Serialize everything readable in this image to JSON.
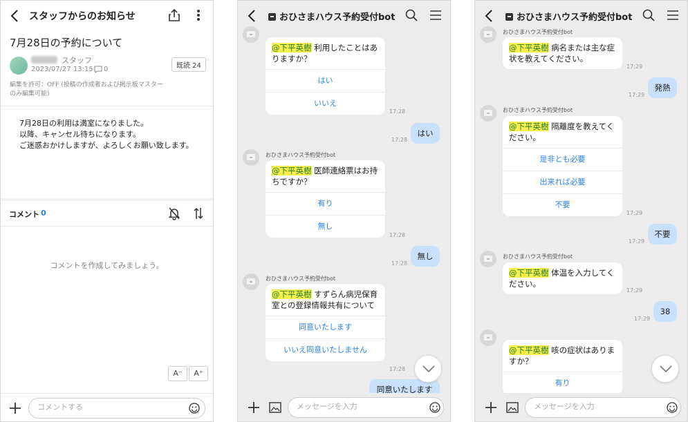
{
  "panel1": {
    "title": "スタッフからのお知らせ",
    "post_title": "7月28日の予約について",
    "author_role": "スタッフ",
    "date": "2023/07/27 13:15",
    "meta_sep": "|",
    "comment_count": "0",
    "read_badge": "既読 24",
    "permission": "編集を許可：OFF (投稿の作成者および掲示板マスターのみ編集可能)",
    "body_lines": [
      "7月28日の利用は満室になりました。",
      "以降、キャンセル待ちになります。",
      "ご迷惑おかけしますが、よろしくお願い致します。"
    ],
    "comment_label": "コメント",
    "comment_label_count": "0",
    "empty_message": "コメントを作成してみましょう。",
    "font_minus": "A⁻",
    "font_plus": "A⁺",
    "input_placeholder": "コメントする"
  },
  "chat_title": "おひさまハウス予約受付bot",
  "sender_name": "おひさまハウス予約受付bot",
  "mention": "@下平英樹",
  "input_placeholder": "メッセージを入力",
  "panel2": {
    "msg1_text": "利用したことはありますか？",
    "msg1_options": [
      "はい",
      "いいえ"
    ],
    "msg1_time": "17:28",
    "reply1": "はい",
    "reply1_time": "17:28",
    "msg2_text": "医師連絡票はお持ちですか？",
    "msg2_options": [
      "有り",
      "無し"
    ],
    "msg2_time": "17:28",
    "reply2": "無し",
    "reply2_time": "17:28",
    "msg3_text": "すずらん病児保育室との登録情報共有について",
    "msg3_options": [
      "同意いたします",
      "いいえ同意いたしません"
    ],
    "msg3_time": "17:28",
    "reply3": "同意いたします"
  },
  "panel3": {
    "msg1_text": "病名または主な症状を教えてください。",
    "msg1_time": "17:29",
    "reply1": "発熱",
    "reply1_time": "17:29",
    "msg2_text": "隔離度を教えてください。",
    "msg2_options": [
      "是非とも必要",
      "出来れば必要",
      "不要"
    ],
    "msg2_time": "17:29",
    "reply2": "不要",
    "reply2_time": "17:29",
    "msg3_text": "体温を入力してください。",
    "msg3_time": "17:29",
    "reply3": "38",
    "reply3_time": "17:29",
    "msg4_text": "咳の症状はありますか？",
    "msg4_options": [
      "有り"
    ]
  }
}
